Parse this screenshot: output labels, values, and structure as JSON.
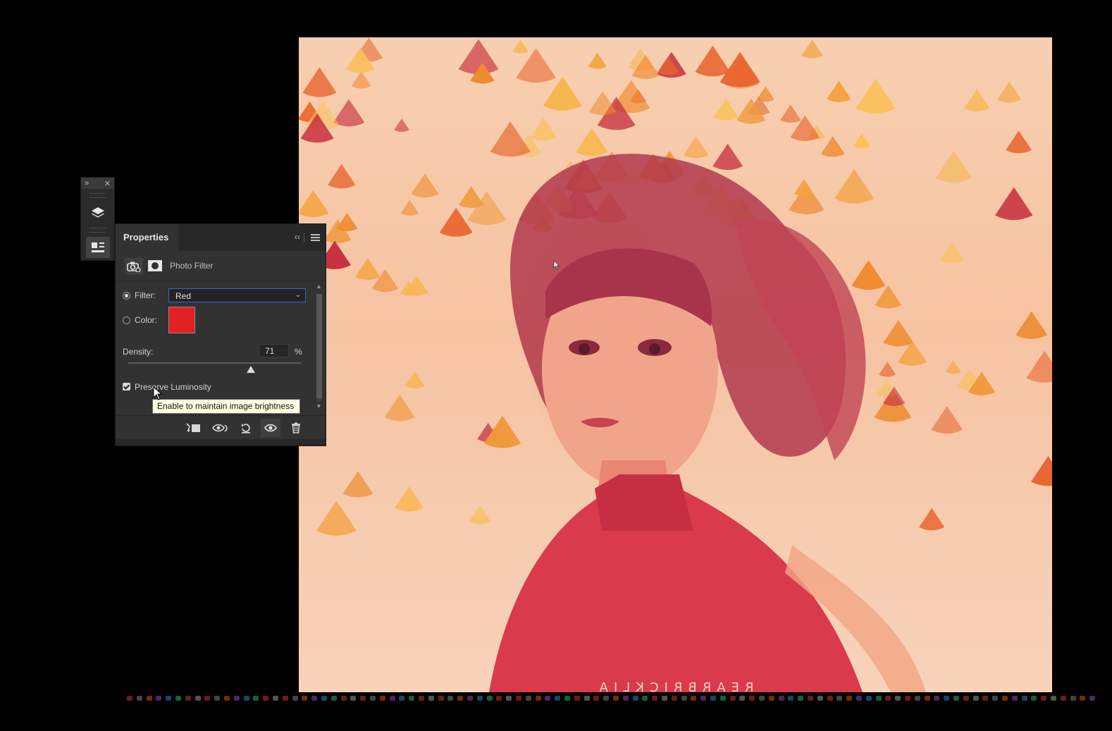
{
  "dock": {
    "expand_glyph": "»",
    "close_glyph": "✕",
    "buttons": [
      {
        "name": "layers-icon"
      },
      {
        "name": "properties-icon"
      }
    ]
  },
  "panel": {
    "tab_label": "Properties",
    "collapse_glyph": "‹‹",
    "adjustment_type": "Photo Filter",
    "filter_label": "Filter:",
    "filter_value": "Red",
    "filter_selected": true,
    "color_label": "Color:",
    "color_value": "#e32123",
    "density_label": "Density:",
    "density_value": "71",
    "density_unit": "%",
    "density_fraction": 0.71,
    "preserve_luminosity_label": "Preserve Luminosity",
    "preserve_luminosity_checked": true,
    "footer_buttons": [
      "clip-to-layer-icon",
      "view-previous-state-icon",
      "reset-adjustments-icon",
      "toggle-visibility-icon",
      "delete-layer-icon"
    ]
  },
  "tooltip": {
    "text": "Enable to maintain image brightness"
  },
  "canvas": {
    "watermark": "REARBRICKLIA",
    "accent": "#e32123"
  },
  "colors": {
    "panel_bg": "#323232",
    "select_border": "#2f6ac9",
    "tooltip_bg": "#ffffe1"
  }
}
